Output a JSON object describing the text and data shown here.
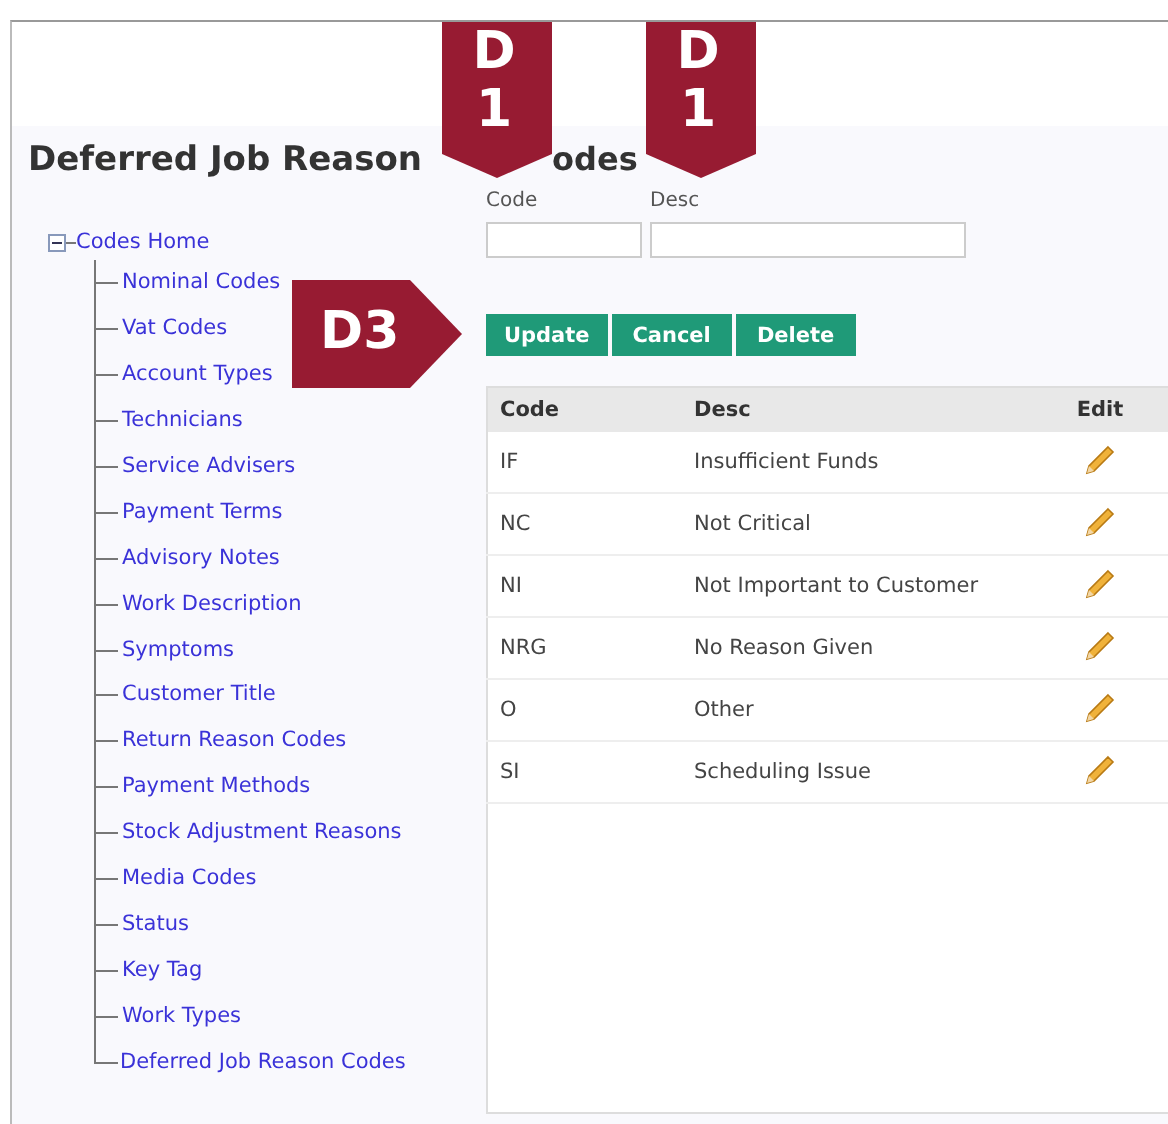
{
  "title": "Deferred Job Reason",
  "title_tail": "odes",
  "annotations": [
    {
      "kind": "down",
      "label": "D1"
    },
    {
      "kind": "down",
      "label": "D1"
    },
    {
      "kind": "right",
      "label": "D3"
    }
  ],
  "tree": {
    "label": "Codes Home",
    "expanded": true,
    "children": [
      {
        "label": "Nominal Codes"
      },
      {
        "label": "Vat Codes"
      },
      {
        "label": "Account Types"
      },
      {
        "label": "Technicians"
      },
      {
        "label": "Service Advisers"
      },
      {
        "label": "Payment Terms"
      },
      {
        "label": "Advisory Notes"
      },
      {
        "label": "Work Description"
      },
      {
        "label": "Symptoms"
      },
      {
        "label": "Customer Title"
      },
      {
        "label": "Return Reason Codes"
      },
      {
        "label": "Payment Methods"
      },
      {
        "label": "Stock Adjustment Reasons"
      },
      {
        "label": "Media Codes"
      },
      {
        "label": "Status"
      },
      {
        "label": "Key Tag"
      },
      {
        "label": "Work Types"
      },
      {
        "label": "Deferred Job Reason Codes"
      }
    ]
  },
  "form": {
    "fields": [
      {
        "label": "Code"
      },
      {
        "label": "Desc"
      }
    ],
    "buttons": [
      "Update",
      "Cancel",
      "Delete"
    ]
  },
  "table": {
    "columns": [
      "Code",
      "Desc",
      "Edit"
    ],
    "rows": [
      {
        "code": "IF",
        "desc": "Insufficient Funds"
      },
      {
        "code": "NC",
        "desc": "Not Critical"
      },
      {
        "code": "NI",
        "desc": "Not Important to Customer"
      },
      {
        "code": "NRG",
        "desc": "No Reason Given"
      },
      {
        "code": "O",
        "desc": "Other"
      },
      {
        "code": "SI",
        "desc": "Scheduling Issue"
      }
    ]
  }
}
